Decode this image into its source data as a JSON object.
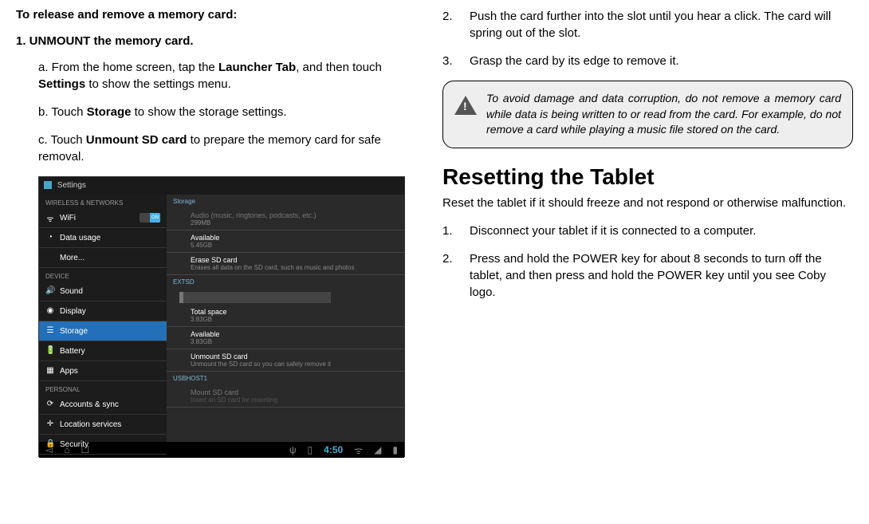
{
  "left": {
    "heading": "To release and remove a memory card:",
    "step1_heading": "1.    UNMOUNT the memory card.",
    "step_a_prefix": "a. From the home screen, tap the ",
    "step_a_bold1": "Launcher Tab",
    "step_a_mid": ", and then touch ",
    "step_a_bold2": "Settings",
    "step_a_suffix": " to show the settings menu.",
    "step_b_prefix": "b. Touch ",
    "step_b_bold": "Storage",
    "step_b_suffix": " to show the storage settings.",
    "step_c_prefix": "c. Touch ",
    "step_c_bold": "Unmount SD card",
    "step_c_suffix": " to prepare the memory card for safe removal."
  },
  "screenshot": {
    "title": "Settings",
    "sections": {
      "wireless": "WIRELESS & NETWORKS",
      "device": "DEVICE",
      "personal": "PERSONAL"
    },
    "sidebar": {
      "wifi": "WiFi",
      "wifi_toggle": "ON",
      "data": "Data usage",
      "more": "More...",
      "sound": "Sound",
      "display": "Display",
      "storage": "Storage",
      "battery": "Battery",
      "apps": "Apps",
      "accounts": "Accounts & sync",
      "location": "Location services",
      "security": "Security"
    },
    "main": {
      "storage_label": "Storage",
      "audio_title": "Audio (music, ringtones, podcasts, etc.)",
      "audio_sub": "299MB",
      "avail1_title": "Available",
      "avail1_sub": "5.45GB",
      "erase_title": "Erase SD card",
      "erase_sub": "Erases all data on the SD card, such as music and photos",
      "extsd": "EXTSD",
      "total_title": "Total space",
      "total_sub": "3.83GB",
      "avail2_title": "Available",
      "avail2_sub": "3.83GB",
      "unmount_title": "Unmount SD card",
      "unmount_sub": "Unmount the SD card so you can safely remove it",
      "usbhost": "USBHOST1",
      "mount_title": "Mount SD card",
      "mount_sub": "Insert an SD card for mounting"
    },
    "navbar": {
      "clock": "4:50"
    }
  },
  "right": {
    "step2_num": "2.",
    "step2_text": "Push the card further into the slot until you hear a click. The card will spring out of the slot.",
    "step3_num": "3.",
    "step3_text": "Grasp the card by its edge to remove it.",
    "warning": "To avoid damage and data corruption, do not remove a memory card while data is being written to or read from the card. For example, do not remove a card while playing a music file stored on the card.",
    "reset_title": "Resetting the Tablet",
    "reset_intro": "Reset the tablet if it should freeze and not respond or otherwise malfunction.",
    "reset1_num": "1.",
    "reset1_text": "Disconnect your tablet if it is connected to a computer.",
    "reset2_num": "2.",
    "reset2_text": "Press and hold the POWER key for about 8 seconds to turn off the tablet, and then press and hold the POWER key until you see Coby logo."
  }
}
